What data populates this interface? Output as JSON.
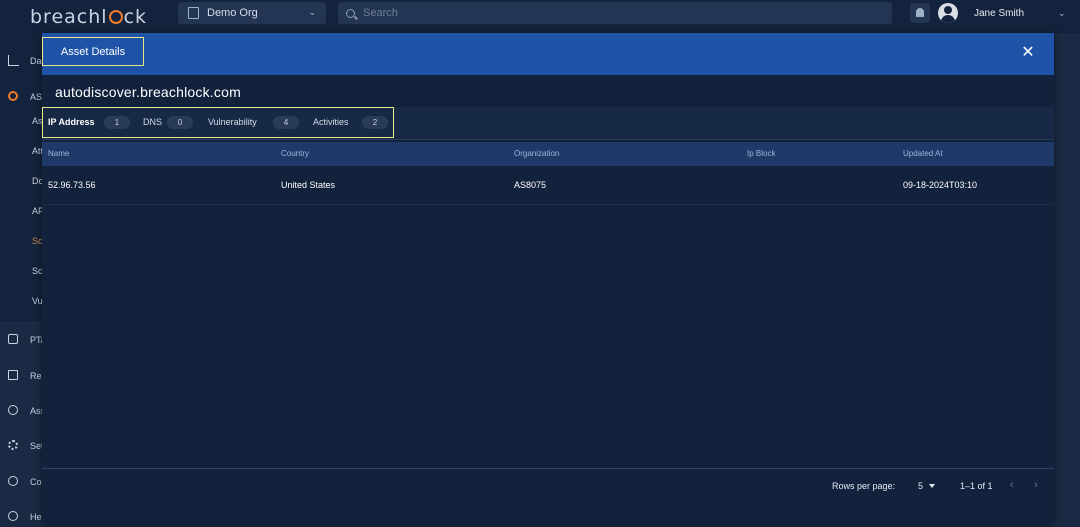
{
  "app": {
    "logo_text_a": "breachl",
    "logo_text_b": "ck",
    "org_select": "Demo Org",
    "search_placeholder": "Search",
    "username": "Jane Smith"
  },
  "sidebar": {
    "items": [
      {
        "label": "Dashboard",
        "icon": "chart-icon"
      },
      {
        "label": "ASM",
        "icon": "target-icon"
      },
      {
        "label": "Assets"
      },
      {
        "label": "Attack Surface"
      },
      {
        "label": "Domains"
      },
      {
        "label": "API"
      },
      {
        "label": "Scans"
      },
      {
        "label": "Scheduled"
      },
      {
        "label": "Vulnerabilities"
      },
      {
        "label": "PTaaS",
        "icon": "users-icon"
      },
      {
        "label": "Reports",
        "icon": "document-icon"
      },
      {
        "label": "Assets",
        "icon": "globe-icon"
      },
      {
        "label": "Settings",
        "icon": "gear-icon"
      },
      {
        "label": "Contact",
        "icon": "chat-icon"
      },
      {
        "label": "Help",
        "icon": "help-icon"
      }
    ]
  },
  "modal": {
    "title": "Asset Details",
    "asset_name": "autodiscover.breachlock.com",
    "close_glyph": "✕",
    "tabs": [
      {
        "label": "IP Address",
        "count": "1",
        "active": true
      },
      {
        "label": "DNS",
        "count": "0"
      },
      {
        "label": "Vulnerability",
        "count": "4"
      },
      {
        "label": "Activities",
        "count": "2"
      }
    ],
    "table": {
      "columns": [
        "Name",
        "Country",
        "Organization",
        "Ip Block",
        "Updated At"
      ],
      "rows": [
        [
          "52.96.73.56",
          "United States",
          "AS8075",
          "",
          "09-18-2024T03:10"
        ]
      ]
    },
    "pagination": {
      "rows_per_page_label": "Rows per page:",
      "rows_per_page_value": "5",
      "page_info": "1–1 of 1",
      "prev_glyph": "‹",
      "next_glyph": "›"
    }
  },
  "colors": {
    "header_blue": "#1e53a8",
    "modal_bg": "#12213c",
    "highlight": "#e8e98a",
    "table_header": "#1f3a68",
    "accent_orange": "#f07b2a"
  }
}
